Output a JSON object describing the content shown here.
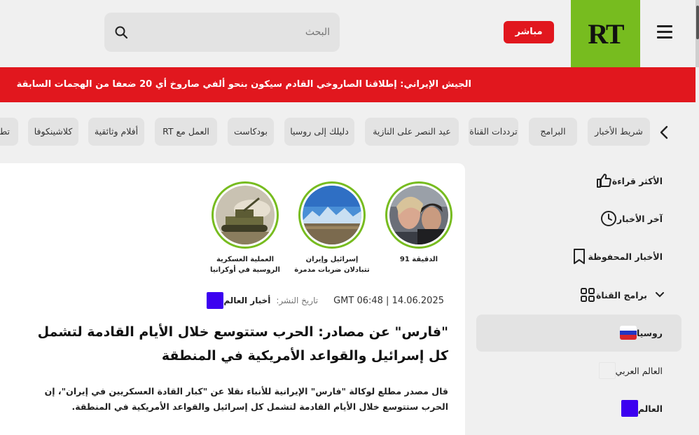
{
  "header": {
    "search_placeholder": "البحث",
    "live_label": "مباشر",
    "logo_text": "RT",
    "brand_color": "#77bc1f",
    "accent_color": "#e1171e"
  },
  "breaking": {
    "text": "الجيش الإيراني: إطلاقنا الصاروخي القادم سيكون بنحو ألفي صاروخ أي 20 ضعفا من الهجمات السابقة"
  },
  "categories": [
    "شريط الأخبار",
    "البرامج",
    "ترددات القناة",
    "عيد النصر على النازية",
    "دليلك إلى روسيا",
    "بودكاست",
    "العمل مع RT",
    "أفلام وثائقية",
    "كلاشينكوفا",
    "تطب"
  ],
  "stories": [
    {
      "label": "الدقيقة 91"
    },
    {
      "label": "إسرائيل وإيران تتبادلان ضربات مدمرة"
    },
    {
      "label": "العملية العسكرية الروسية في أوكرانيا"
    }
  ],
  "article": {
    "category": "أخبار العالم",
    "date_label": "تاريخ النشر:",
    "date": "14.06.2025 | 06:48 GMT",
    "headline": "\"فارس\" عن مصادر: الحرب ستتوسع خلال الأيام القادمة لتشمل كل إسرائيل والقواعد الأمريكية في المنطقة",
    "lead": "قال مصدر مطلع لوكالة \"فارس\" الإيرانية للأنباء نقلا عن \"كبار القادة العسكريين في إيران\"، إن الحرب ستتوسع خلال الأيام القادمة لتشمل كل إسرائيل والقواعد الأمريكية في المنطقة."
  },
  "sidebar": {
    "items": [
      {
        "label": "الأكثر قراءة",
        "icon": "thumbs-up-icon"
      },
      {
        "label": "آخر الأخبار",
        "icon": "clock-icon"
      },
      {
        "label": "الأخبار المحفوظة",
        "icon": "bookmark-icon"
      },
      {
        "label": "برامج القناة",
        "icon": "grid-icon"
      },
      {
        "label": "روسيا",
        "icon": "russia-flag-icon"
      },
      {
        "label": "العالم العربي",
        "icon": "arab-world-icon"
      },
      {
        "label": "العالم",
        "icon": "world-icon"
      }
    ]
  }
}
